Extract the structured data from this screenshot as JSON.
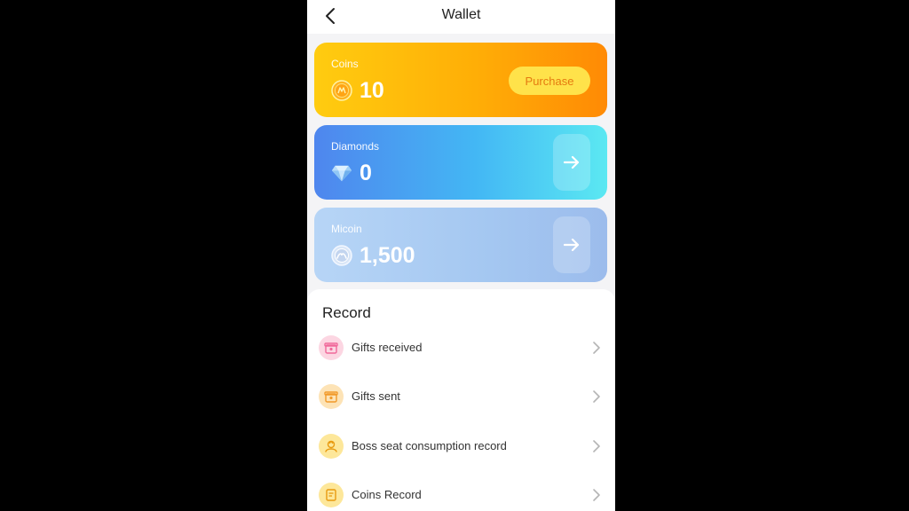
{
  "header": {
    "title": "Wallet",
    "back_icon": "chevron-left-icon"
  },
  "wallet": {
    "coins": {
      "label": "Coins",
      "value": "10",
      "icon": "coin-icon",
      "purchase_label": "Purchase",
      "colors": [
        "#ffcc10",
        "#ff8a05"
      ]
    },
    "diamonds": {
      "label": "Diamonds",
      "value": "0",
      "icon": "diamond-icon",
      "action_icon": "arrow-right-icon",
      "colors": [
        "#4f86ee",
        "#5be8f2"
      ]
    },
    "micoin": {
      "label": "Micoin",
      "value": "1,500",
      "icon": "micoin-icon",
      "action_icon": "arrow-right-icon",
      "colors": [
        "#b7d5f6",
        "#9cbcec"
      ]
    }
  },
  "record": {
    "title": "Record",
    "items": [
      {
        "label": "Gifts received",
        "icon": "gift-box-icon",
        "color": "#fcd6e2"
      },
      {
        "label": "Gifts sent",
        "icon": "gift-box-icon",
        "color": "#fde3b6"
      },
      {
        "label": "Boss seat consumption record",
        "icon": "boss-seat-icon",
        "color": "#fde79a"
      },
      {
        "label": "Coins Record",
        "icon": "document-icon",
        "color": "#fde79a"
      }
    ]
  }
}
